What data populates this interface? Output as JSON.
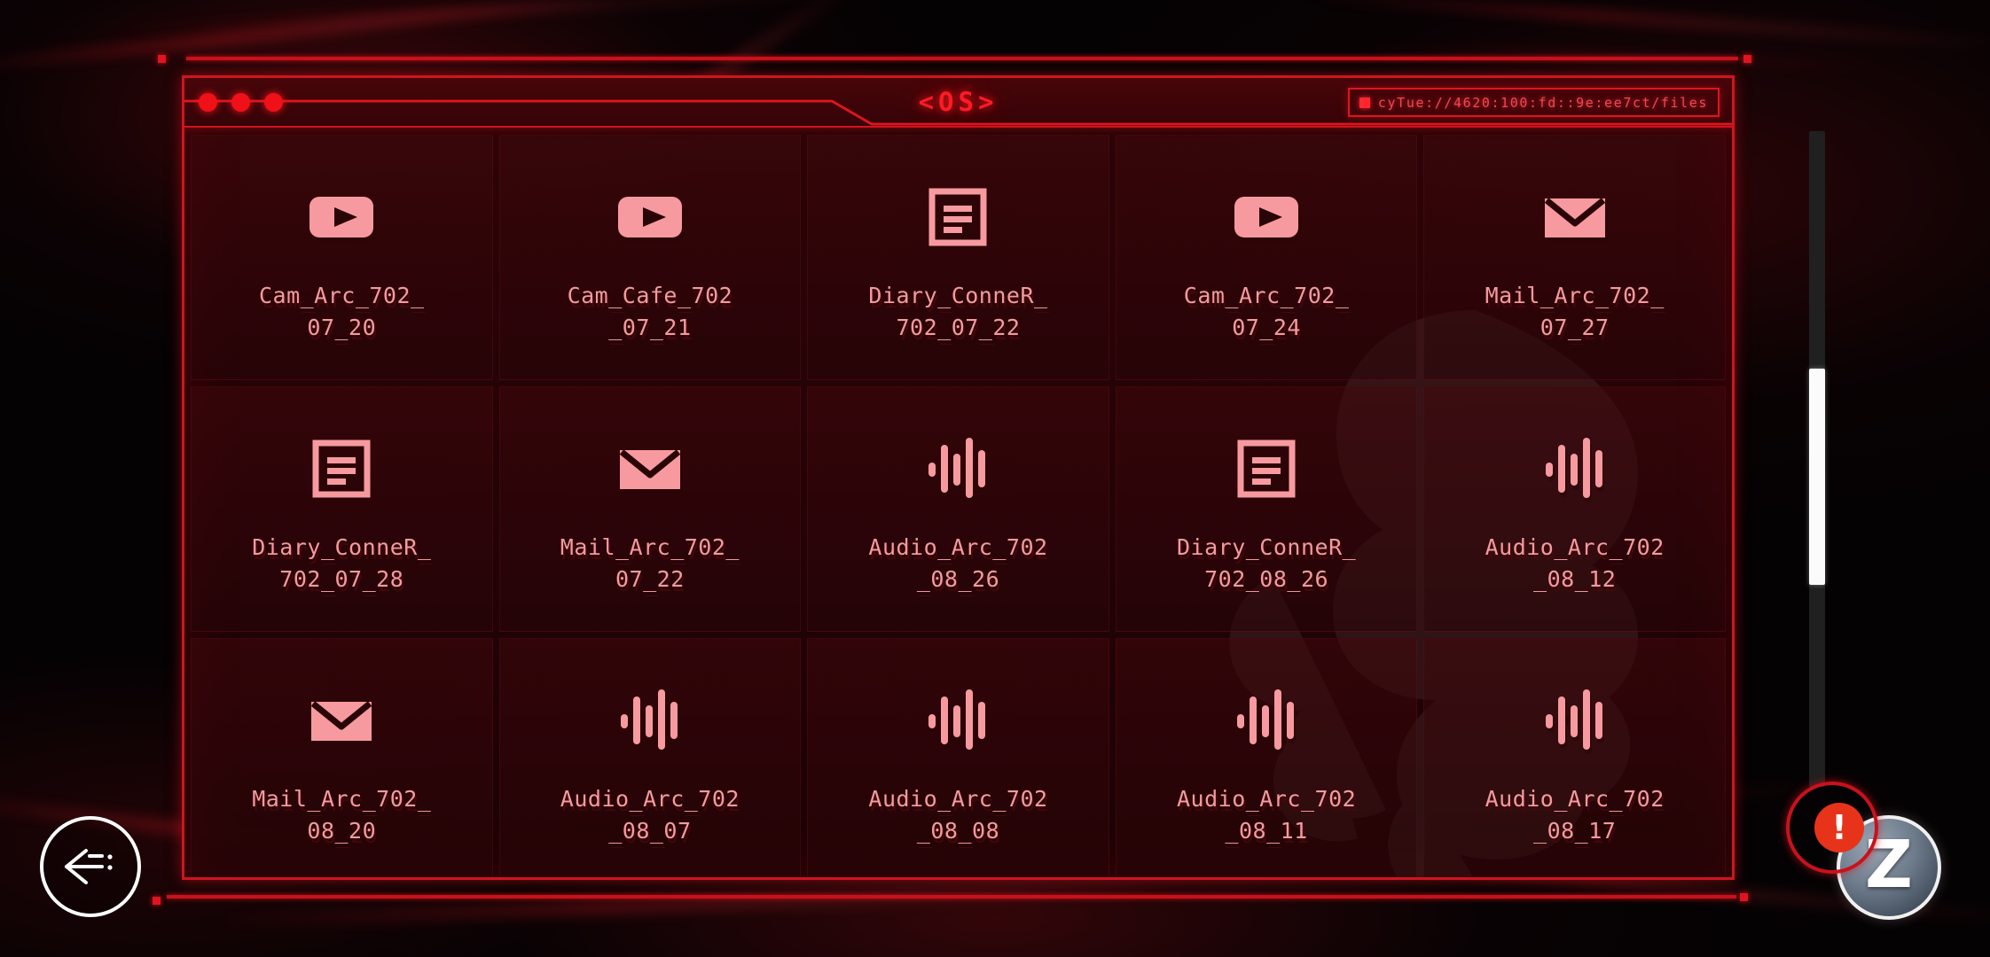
{
  "window": {
    "title": "<OS>",
    "url": "cyTue://4620:100:fd::9e:ee7ct/files",
    "traffic_lights": [
      "close",
      "minimize",
      "maximize"
    ]
  },
  "controls": {
    "back_label": "back",
    "z_label": "Z",
    "alert_label": "!"
  },
  "scrollbar": {
    "position_percent": 36
  },
  "files": [
    {
      "name": "Cam_Arc_702_07_20",
      "label_line1": "Cam_Arc_702_",
      "label_line2": "07_20",
      "type": "video"
    },
    {
      "name": "Cam_Cafe_702_07_21",
      "label_line1": "Cam_Cafe_702",
      "label_line2": "_07_21",
      "type": "video"
    },
    {
      "name": "Diary_ConneR_702_07_22",
      "label_line1": "Diary_ConneR_",
      "label_line2": "702_07_22",
      "type": "document"
    },
    {
      "name": "Cam_Arc_702_07_24",
      "label_line1": "Cam_Arc_702_",
      "label_line2": "07_24",
      "type": "video"
    },
    {
      "name": "Mail_Arc_702_07_27",
      "label_line1": "Mail_Arc_702_",
      "label_line2": "07_27",
      "type": "mail"
    },
    {
      "name": "Diary_ConneR_702_07_28",
      "label_line1": "Diary_ConneR_",
      "label_line2": "702_07_28",
      "type": "document"
    },
    {
      "name": "Mail_Arc_702_07_22",
      "label_line1": "Mail_Arc_702_",
      "label_line2": "07_22",
      "type": "mail"
    },
    {
      "name": "Audio_Arc_702_08_26",
      "label_line1": "Audio_Arc_702",
      "label_line2": "_08_26",
      "type": "audio"
    },
    {
      "name": "Diary_ConneR_702_08_26",
      "label_line1": "Diary_ConneR_",
      "label_line2": "702_08_26",
      "type": "document"
    },
    {
      "name": "Audio_Arc_702_08_12",
      "label_line1": "Audio_Arc_702",
      "label_line2": "_08_12",
      "type": "audio"
    },
    {
      "name": "Mail_Arc_702_08_20",
      "label_line1": "Mail_Arc_702_",
      "label_line2": "08_20",
      "type": "mail"
    },
    {
      "name": "Audio_Arc_702_08_07",
      "label_line1": "Audio_Arc_702",
      "label_line2": "_08_07",
      "type": "audio"
    },
    {
      "name": "Audio_Arc_702_08_08",
      "label_line1": "Audio_Arc_702",
      "label_line2": "_08_08",
      "type": "audio"
    },
    {
      "name": "Audio_Arc_702_08_11",
      "label_line1": "Audio_Arc_702",
      "label_line2": "_08_11",
      "type": "audio"
    },
    {
      "name": "Audio_Arc_702_08_17",
      "label_line1": "Audio_Arc_702",
      "label_line2": "_08_17",
      "type": "audio"
    }
  ],
  "colors": {
    "accent_red": "#d0141f",
    "bright_red": "#ff1a24",
    "icon_pink": "#f79a9f",
    "icon_dark": "#2a0508",
    "label_pink": "#f49a9f",
    "scroll_thumb": "#fbfbfb",
    "badge_red": "#e8331b"
  }
}
